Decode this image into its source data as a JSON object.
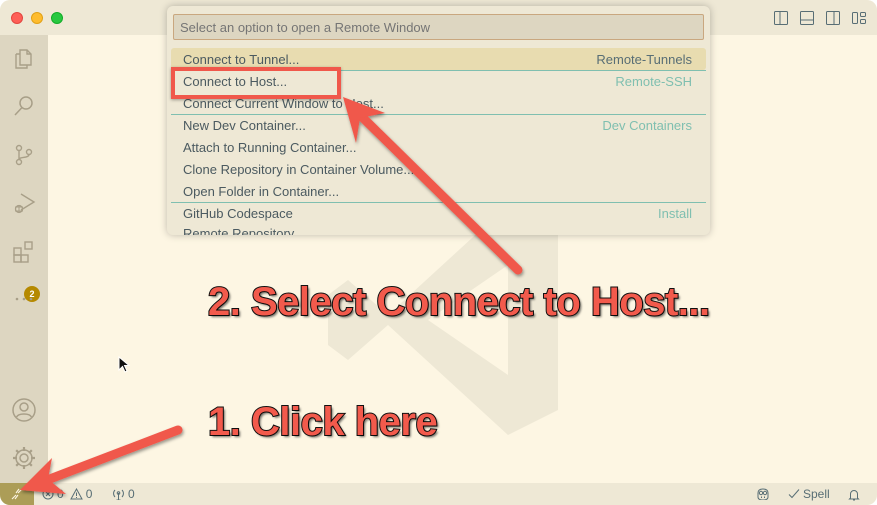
{
  "window": {
    "layout_controls": [
      "toggle-primary-sidebar",
      "toggle-panel",
      "toggle-secondary-sidebar",
      "customize-layout"
    ]
  },
  "activity_bar": {
    "items": [
      {
        "name": "explorer",
        "icon": "files-icon"
      },
      {
        "name": "search",
        "icon": "search-icon"
      },
      {
        "name": "source-control",
        "icon": "source-control-icon"
      },
      {
        "name": "run-and-debug",
        "icon": "run-debug-icon"
      },
      {
        "name": "extensions",
        "icon": "extensions-icon",
        "badge": "2"
      },
      {
        "name": "more",
        "icon": "ellipsis-icon"
      }
    ],
    "bottom": [
      {
        "name": "accounts",
        "icon": "account-icon"
      },
      {
        "name": "manage",
        "icon": "gear-icon"
      }
    ],
    "extensions_badge": "2"
  },
  "quick_pick": {
    "placeholder": "Select an option to open a Remote Window",
    "items": [
      {
        "label": "Connect to Tunnel...",
        "detail": "Remote-Tunnels",
        "active": true
      },
      {
        "label": "Connect to Host...",
        "detail": "Remote-SSH"
      },
      {
        "label": "Connect Current Window to Host...",
        "detail": ""
      },
      {
        "label": "New Dev Container...",
        "detail": "Dev Containers"
      },
      {
        "label": "Attach to Running Container...",
        "detail": ""
      },
      {
        "label": "Clone Repository in Container Volume...",
        "detail": ""
      },
      {
        "label": "Open Folder in Container...",
        "detail": ""
      },
      {
        "label": "GitHub Codespace",
        "detail": "Install"
      },
      {
        "label": "Remote Repository",
        "detail": ""
      }
    ]
  },
  "status_bar": {
    "remote_icon": "remote-indicator-icon",
    "errors": "0",
    "warnings": "0",
    "ports": "0",
    "copilot_icon": "copilot-icon",
    "spell_label": "Spell",
    "notifications_icon": "bell-icon"
  },
  "annotations": {
    "step1": "1. Click here",
    "step2": "2. Select Connect to Host...",
    "color": "#f25a4c"
  }
}
